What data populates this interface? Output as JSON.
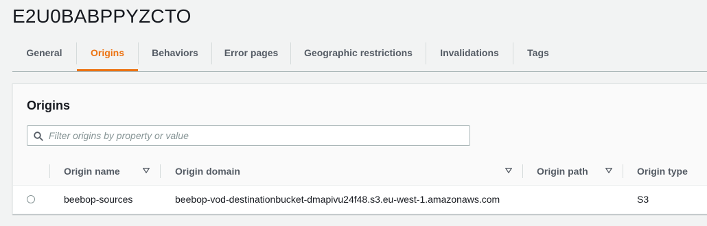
{
  "page": {
    "title": "E2U0BABPPYZCTO"
  },
  "tabs": [
    {
      "label": "General",
      "active": false
    },
    {
      "label": "Origins",
      "active": true
    },
    {
      "label": "Behaviors",
      "active": false
    },
    {
      "label": "Error pages",
      "active": false
    },
    {
      "label": "Geographic restrictions",
      "active": false
    },
    {
      "label": "Invalidations",
      "active": false
    },
    {
      "label": "Tags",
      "active": false
    }
  ],
  "origins": {
    "title": "Origins",
    "filter": {
      "placeholder": "Filter origins by property or value",
      "value": ""
    },
    "columns": [
      "Origin name",
      "Origin domain",
      "Origin path",
      "Origin type"
    ],
    "rows": [
      {
        "name": "beebop-sources",
        "domain": "beebop-vod-destinationbucket-dmapivu24f48.s3.eu-west-1.amazonaws.com",
        "path": "",
        "type": "S3"
      }
    ]
  },
  "colors": {
    "accent": "#ec7211",
    "text": "#16191f",
    "muted": "#545b64",
    "border": "#aab7b8"
  },
  "icons": {
    "filter": "search-icon",
    "sort": "caret-down-icon",
    "row_select": "radio-icon"
  }
}
